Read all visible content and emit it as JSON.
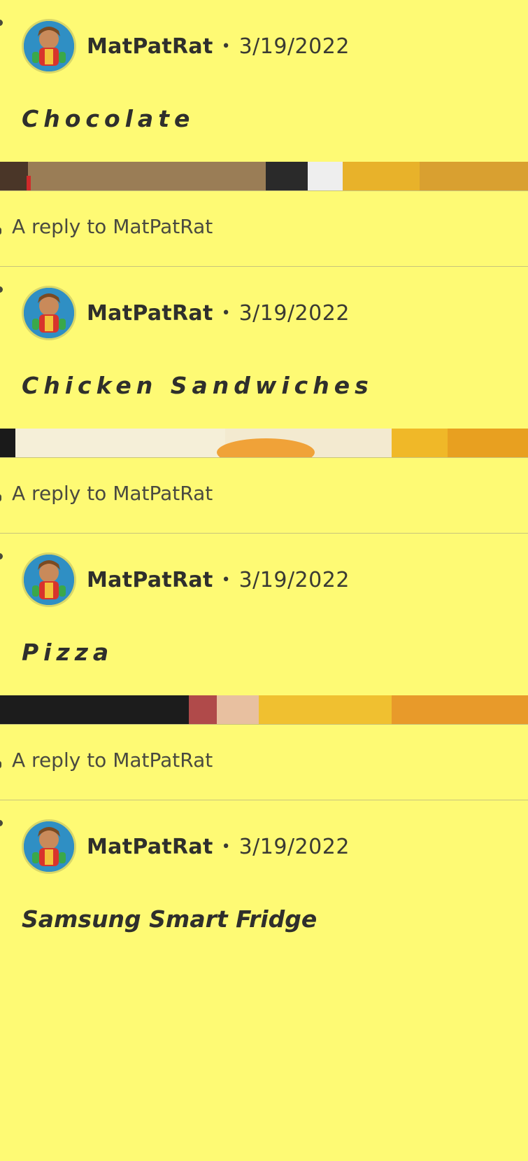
{
  "posts": [
    {
      "username": "MatPatRat",
      "separator": "•",
      "date": "3/19/2022",
      "body": "Chocolate",
      "avatar_icon": "character-avatar-icon"
    },
    {
      "username": "MatPatRat",
      "separator": "•",
      "date": "3/19/2022",
      "body": "Chicken Sandwiches",
      "avatar_icon": "character-avatar-icon"
    },
    {
      "username": "MatPatRat",
      "separator": "•",
      "date": "3/19/2022",
      "body": "Pizza",
      "avatar_icon": "character-avatar-icon"
    },
    {
      "username": "MatPatRat",
      "separator": "•",
      "date": "3/19/2022",
      "body": "Samsung Smart Fridge",
      "avatar_icon": "character-avatar-icon"
    }
  ],
  "replies": [
    {
      "text": "A reply to MatPatRat"
    },
    {
      "text": "A reply to MatPatRat"
    },
    {
      "text": "A reply to MatPatRat"
    }
  ],
  "colors": {
    "background": "#fefa74",
    "divider": "#c9c57a",
    "text": "#3a3a33"
  }
}
